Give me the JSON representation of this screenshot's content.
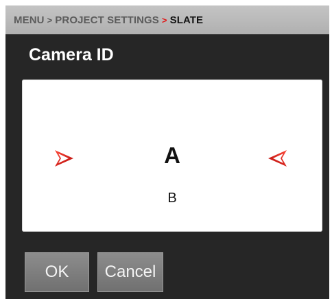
{
  "breadcrumb": {
    "items": [
      "MENU",
      "PROJECT SETTINGS"
    ],
    "current": "SLATE",
    "separator": ">"
  },
  "dialog": {
    "title": "Camera ID"
  },
  "picker": {
    "current_value": "A",
    "next_value": "B",
    "prev_icon": "red-right-arrow-icon",
    "next_icon": "red-left-arrow-icon"
  },
  "buttons": {
    "ok_label": "OK",
    "cancel_label": "Cancel"
  },
  "colors": {
    "accent": "#e01818",
    "panel_bg": "#262626",
    "breadcrumb_bg": "#bababa",
    "button_bg": "#7f7f7f"
  }
}
